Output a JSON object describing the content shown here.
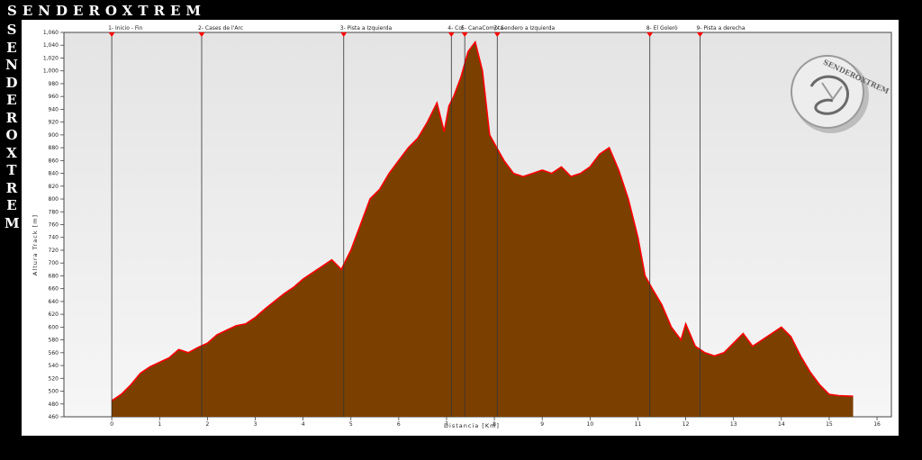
{
  "brand": {
    "name": "SENDEROXTREM",
    "logo_text": "SENDEROXTREM"
  },
  "colors": {
    "fill": "#7b4000",
    "line": "#ff0000",
    "plot_bg_top": "#e4e4e4",
    "plot_bg_bottom": "#f6f6f6"
  },
  "chart_data": {
    "type": "area",
    "title": "",
    "xlabel": "Distancia [Km]",
    "ylabel": "Altura Track [m]",
    "xlim": [
      -1,
      16.3
    ],
    "ylim": [
      460,
      1060
    ],
    "xticks": [
      0,
      1,
      2,
      3,
      4,
      5,
      6,
      7,
      8,
      9,
      10,
      11,
      12,
      13,
      14,
      15,
      16
    ],
    "yticks": [
      460,
      480,
      500,
      520,
      540,
      560,
      580,
      600,
      620,
      640,
      660,
      680,
      700,
      720,
      740,
      760,
      780,
      800,
      820,
      840,
      860,
      880,
      900,
      920,
      940,
      960,
      980,
      1000,
      1020,
      1040,
      1060
    ],
    "waypoints": [
      {
        "label": "1- Inicio - Fin",
        "x": 0
      },
      {
        "label": "2- Cases de l'Arc",
        "x": 1.88
      },
      {
        "label": "3- Pista a Izquierda",
        "x": 4.85
      },
      {
        "label": "4- Col",
        "x": 7.1
      },
      {
        "label": "5- CanaCompta",
        "x": 7.38
      },
      {
        "label": "7- Sendero a Izquierda",
        "x": 8.06
      },
      {
        "label": "8- El Golerò",
        "x": 11.25
      },
      {
        "label": "9- Pista a derecha",
        "x": 12.3
      }
    ],
    "x": [
      0,
      0.2,
      0.4,
      0.6,
      0.8,
      1.0,
      1.2,
      1.4,
      1.6,
      1.8,
      2.0,
      2.2,
      2.4,
      2.6,
      2.8,
      3.0,
      3.2,
      3.4,
      3.6,
      3.8,
      4.0,
      4.2,
      4.4,
      4.6,
      4.8,
      5.0,
      5.2,
      5.4,
      5.6,
      5.8,
      6.0,
      6.2,
      6.4,
      6.6,
      6.8,
      6.95,
      7.05,
      7.15,
      7.3,
      7.45,
      7.6,
      7.75,
      7.9,
      8.05,
      8.2,
      8.4,
      8.6,
      8.8,
      9.0,
      9.2,
      9.4,
      9.6,
      9.8,
      10.0,
      10.2,
      10.4,
      10.6,
      10.8,
      11.0,
      11.15,
      11.3,
      11.5,
      11.7,
      11.9,
      12.0,
      12.2,
      12.4,
      12.6,
      12.8,
      13.0,
      13.2,
      13.4,
      13.6,
      13.8,
      14.0,
      14.2,
      14.4,
      14.6,
      14.8,
      15.0,
      15.2,
      15.5
    ],
    "y": [
      485,
      495,
      510,
      528,
      538,
      545,
      552,
      565,
      560,
      568,
      575,
      588,
      595,
      602,
      605,
      615,
      628,
      640,
      652,
      662,
      675,
      685,
      695,
      705,
      690,
      720,
      760,
      800,
      815,
      840,
      860,
      880,
      895,
      920,
      950,
      905,
      945,
      960,
      990,
      1030,
      1045,
      1000,
      900,
      880,
      860,
      840,
      835,
      840,
      845,
      840,
      850,
      835,
      840,
      850,
      870,
      880,
      845,
      800,
      740,
      680,
      660,
      635,
      600,
      580,
      605,
      570,
      560,
      555,
      560,
      575,
      590,
      570,
      580,
      590,
      600,
      585,
      555,
      530,
      510,
      495,
      493,
      492
    ]
  }
}
